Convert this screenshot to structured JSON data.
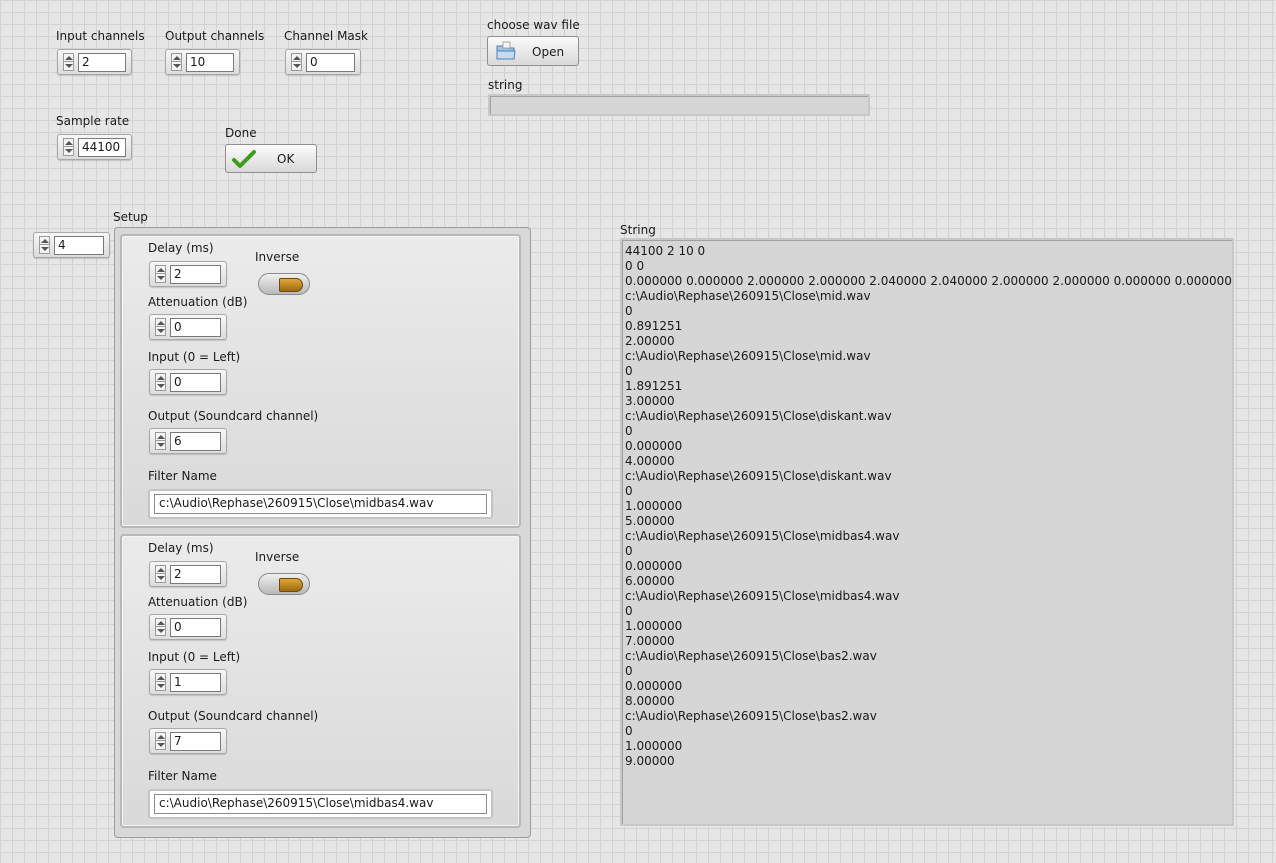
{
  "top": {
    "input_channels": {
      "label": "Input channels",
      "value": "2"
    },
    "output_channels": {
      "label": "Output channels",
      "value": "10"
    },
    "channel_mask": {
      "label": "Channel Mask",
      "value": "0"
    },
    "sample_rate": {
      "label": "Sample rate",
      "value": "44100"
    },
    "done": {
      "label": "Done",
      "button": "OK"
    },
    "choose_wav": {
      "label": "choose wav file",
      "button": "Open"
    },
    "string_small": {
      "label": "string",
      "value": ""
    }
  },
  "setup": {
    "label": "Setup",
    "index": "4",
    "elements": [
      {
        "delay_label": "Delay (ms)",
        "delay": "2",
        "inverse_label": "Inverse",
        "attenuation_label": "Attenuation (dB)",
        "attenuation": "0",
        "input_label": "Input (0 = Left)",
        "input": "0",
        "output_label": "Output (Soundcard channel)",
        "output": "6",
        "filter_label": "Filter Name",
        "filter": "c:\\Audio\\Rephase\\260915\\Close\\midbas4.wav"
      },
      {
        "delay_label": "Delay (ms)",
        "delay": "2",
        "inverse_label": "Inverse",
        "attenuation_label": "Attenuation (dB)",
        "attenuation": "0",
        "input_label": "Input (0 = Left)",
        "input": "1",
        "output_label": "Output (Soundcard channel)",
        "output": "7",
        "filter_label": "Filter Name",
        "filter": "c:\\Audio\\Rephase\\260915\\Close\\midbas4.wav"
      }
    ]
  },
  "output_string": {
    "label": "String",
    "lines": [
      "44100 2 10 0",
      "0 0",
      "0.000000 0.000000 2.000000 2.000000 2.040000 2.040000 2.000000 2.000000 0.000000 0.000000",
      "c:\\Audio\\Rephase\\260915\\Close\\mid.wav",
      "0",
      "0.891251",
      "2.00000",
      "c:\\Audio\\Rephase\\260915\\Close\\mid.wav",
      "0",
      "1.891251",
      "3.00000",
      "c:\\Audio\\Rephase\\260915\\Close\\diskant.wav",
      "0",
      "0.000000",
      "4.00000",
      "c:\\Audio\\Rephase\\260915\\Close\\diskant.wav",
      "0",
      "1.000000",
      "5.00000",
      "c:\\Audio\\Rephase\\260915\\Close\\midbas4.wav",
      "0",
      "0.000000",
      "6.00000",
      "c:\\Audio\\Rephase\\260915\\Close\\midbas4.wav",
      "0",
      "1.000000",
      "7.00000",
      "c:\\Audio\\Rephase\\260915\\Close\\bas2.wav",
      "0",
      "0.000000",
      "8.00000",
      "c:\\Audio\\Rephase\\260915\\Close\\bas2.wav",
      "0",
      "1.000000",
      "9.00000"
    ]
  }
}
